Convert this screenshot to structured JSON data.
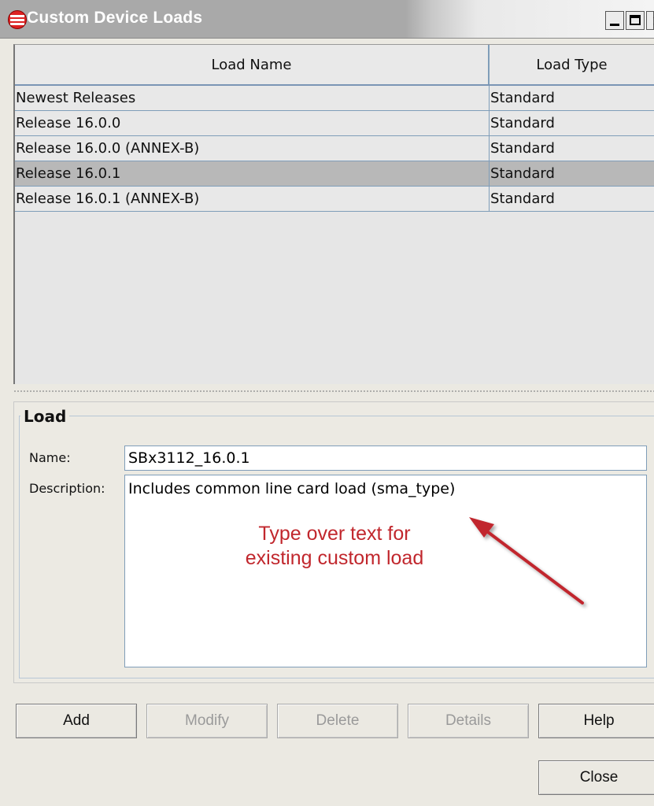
{
  "window": {
    "title": "Custom Device Loads",
    "controls": {
      "minimize": "minimize-icon",
      "maximize": "maximize-icon",
      "close": "close-icon"
    }
  },
  "table": {
    "headers": [
      "Load Name",
      "Load Type"
    ],
    "rows": [
      {
        "name": "Newest Releases",
        "type": "Standard",
        "selected": false
      },
      {
        "name": "Release 16.0.0",
        "type": "Standard",
        "selected": false
      },
      {
        "name": "Release 16.0.0 (ANNEX-B)",
        "type": "Standard",
        "selected": false
      },
      {
        "name": "Release 16.0.1",
        "type": "Standard",
        "selected": true
      },
      {
        "name": "Release 16.0.1 (ANNEX-B)",
        "type": "Standard",
        "selected": false
      }
    ]
  },
  "load": {
    "group_label": "Load",
    "name_label": "Name:",
    "name_value": "SBx3112_16.0.1",
    "description_label": "Description:",
    "description_value": "Includes common line card load (sma_type)"
  },
  "annotation": {
    "line1": "Type over text for",
    "line2": "existing custom load",
    "color": "#c1272d"
  },
  "buttons": {
    "add": "Add",
    "modify": "Modify",
    "delete": "Delete",
    "details": "Details",
    "help": "Help",
    "close": "Close"
  },
  "colors": {
    "selected_row": "#b8b8b8",
    "border_blue": "#7f9db9"
  }
}
